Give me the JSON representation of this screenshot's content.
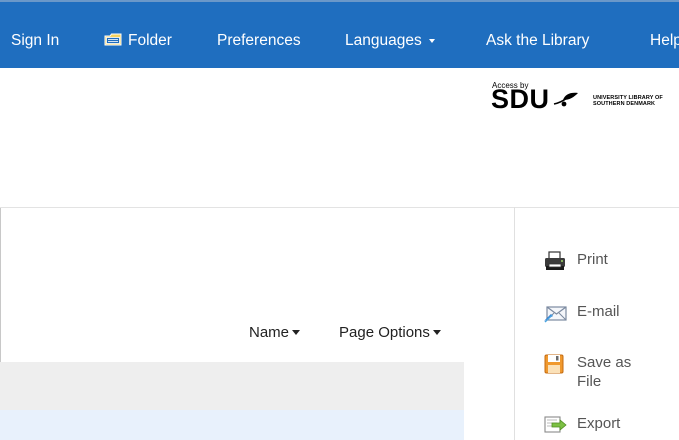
{
  "nav": {
    "sign_in": "Sign In",
    "folder": "Folder",
    "preferences": "Preferences",
    "languages": "Languages",
    "ask_library": "Ask the Library",
    "help": "Help"
  },
  "logo": {
    "access_by": "Access by",
    "brand": "SDU",
    "line1": "UNIVERSITY LIBRARY OF",
    "line2": "SOUTHERN DENMARK"
  },
  "main": {
    "sort_label": "Name",
    "page_options_label": "Page Options"
  },
  "tools": {
    "print": "Print",
    "email": "E-mail",
    "save_as_file": "Save as File",
    "export": "Export"
  },
  "colors": {
    "nav_bar": "#1f6ebf",
    "gray_band": "#eeeeee",
    "blue_band": "#e8f1fc",
    "tool_text": "#555555"
  },
  "icons": {
    "folder": "folder-icon",
    "languages_caret": "caret-down-icon",
    "logo_leaf": "leaf-icon",
    "print": "printer-icon",
    "email": "envelope-icon",
    "save": "floppy-disk-icon",
    "export": "export-arrow-icon"
  }
}
